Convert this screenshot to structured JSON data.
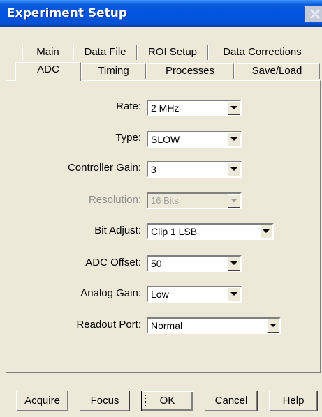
{
  "window": {
    "title": "Experiment Setup"
  },
  "tabs_row1": [
    "Main",
    "Data File",
    "ROI Setup",
    "Data Corrections"
  ],
  "tabs_row2": [
    "ADC",
    "Timing",
    "Processes",
    "Save/Load"
  ],
  "selected_tab": "ADC",
  "fields": {
    "rate": {
      "label": "Rate:",
      "value": "2 MHz"
    },
    "type": {
      "label": "Type:",
      "value": "SLOW"
    },
    "controller_gain": {
      "label": "Controller Gain:",
      "value": "3"
    },
    "resolution": {
      "label": "Resolution:",
      "value": "16 Bits",
      "disabled": true
    },
    "bit_adjust": {
      "label": "Bit Adjust:",
      "value": "Clip 1 LSB"
    },
    "adc_offset": {
      "label": "ADC Offset:",
      "value": "50"
    },
    "analog_gain": {
      "label": "Analog Gain:",
      "value": "Low"
    },
    "readout_port": {
      "label": "Readout Port:",
      "value": "Normal"
    }
  },
  "buttons": {
    "acquire": "Acquire",
    "focus": "Focus",
    "ok": "OK",
    "cancel": "Cancel",
    "help": "Help"
  }
}
